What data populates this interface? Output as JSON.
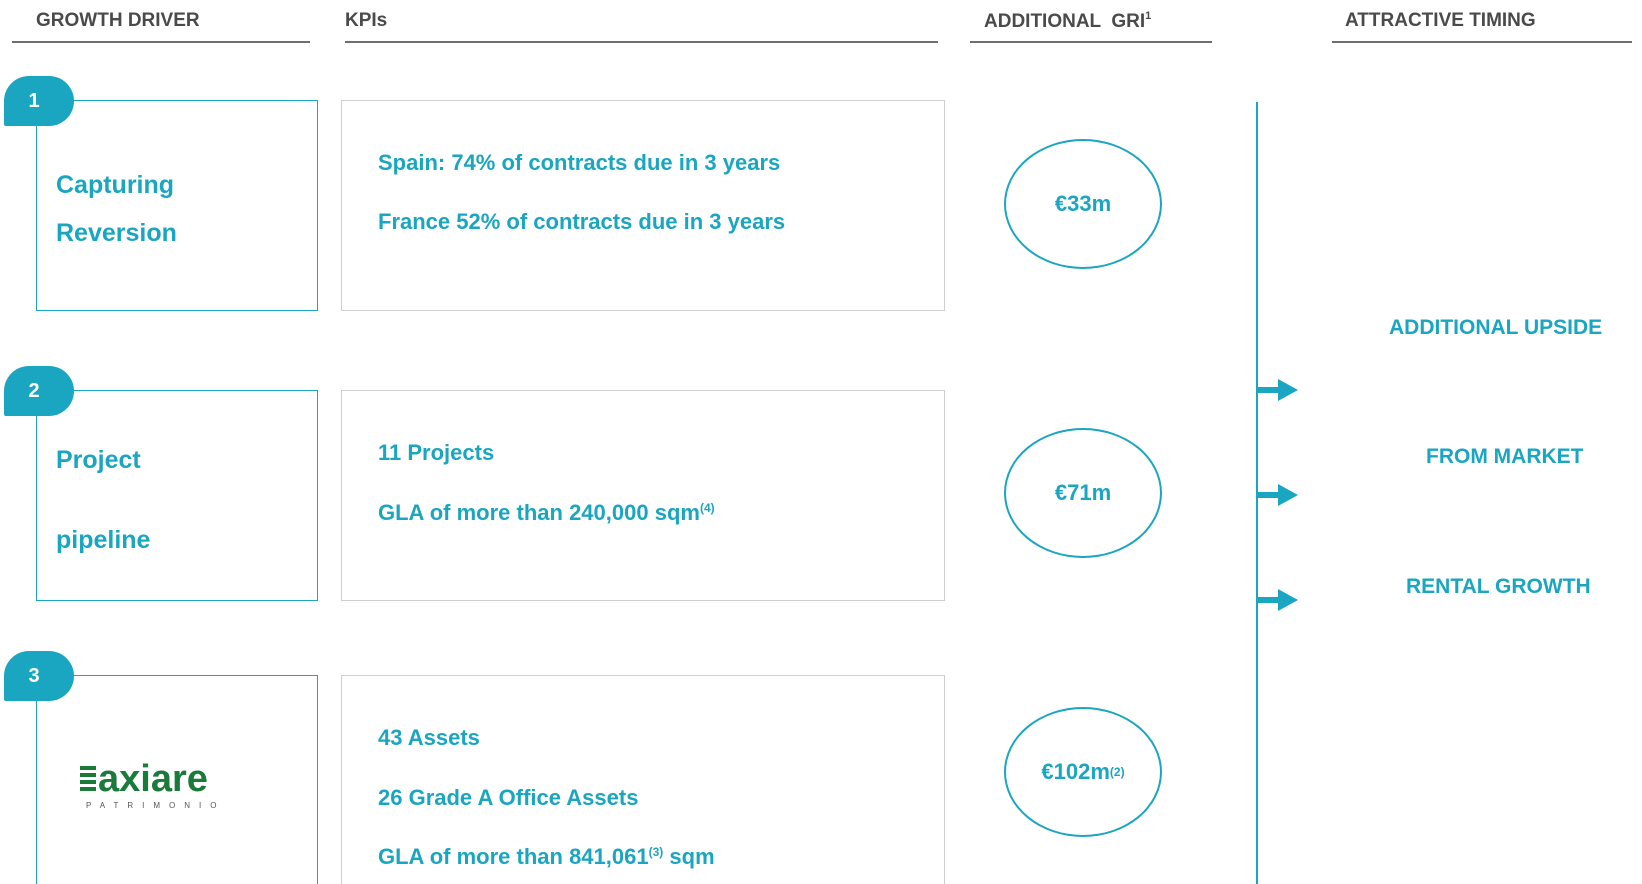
{
  "headers": {
    "growth_driver": "GROWTH DRIVER",
    "kpis": "KPIs",
    "additional_gri": "ADDITIONAL  GRI",
    "additional_gri_sup": "1",
    "attractive_timing": "ATTRACTIVE TIMING"
  },
  "drivers": [
    {
      "number": "1",
      "lines": [
        "Capturing",
        "Reversion"
      ],
      "kpis": [
        {
          "text": "Spain: 74% of contracts due in 3 years"
        },
        {
          "text": "France 52% of contracts due in 3 years"
        }
      ],
      "gri": {
        "value": "€33m",
        "sup": ""
      }
    },
    {
      "number": "2",
      "lines": [
        "Project",
        "pipeline"
      ],
      "kpis": [
        {
          "text": "11 Projects"
        },
        {
          "text": "GLA of more than 240,000 sqm",
          "sup": "(4)"
        }
      ],
      "gri": {
        "value": "€71m",
        "sup": ""
      }
    },
    {
      "number": "3",
      "logo": {
        "name": "axiare",
        "tagline": "PATRIMONIO",
        "color": "#1a7a3a"
      },
      "kpis": [
        {
          "text": "43 Assets"
        },
        {
          "text": "26 Grade A Office Assets"
        },
        {
          "text_before": "GLA of more than 841,061",
          "sup": "(3)",
          "text_after": " sqm"
        }
      ],
      "gri": {
        "value": "€102m",
        "sup": "(2)"
      }
    }
  ],
  "timing": {
    "line1": "ADDITIONAL UPSIDE",
    "line2": "FROM MARKET",
    "line3": "RENTAL GROWTH"
  },
  "colors": {
    "accent": "#1aa6c0",
    "header_text": "#4a4a4a",
    "kpi_border": "#cfcfcf",
    "logo_green": "#1a7a3a"
  }
}
